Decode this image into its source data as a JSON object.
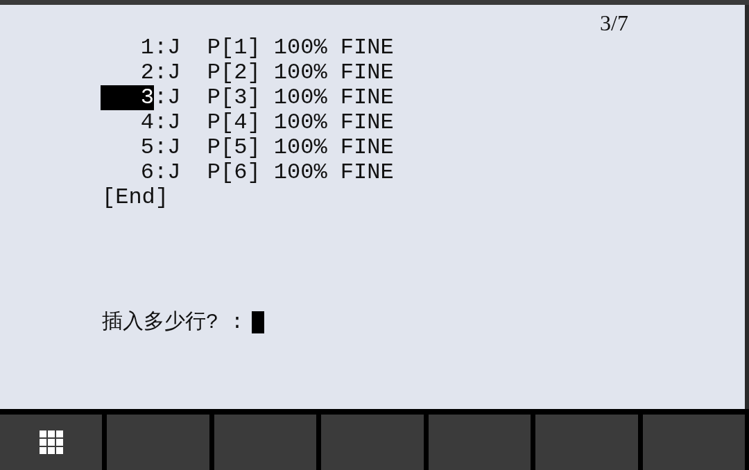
{
  "page_indicator": "3/7",
  "lines": [
    {
      "number": "1",
      "text": ":J  P[1] 100% FINE",
      "selected": false
    },
    {
      "number": "2",
      "text": ":J  P[2] 100% FINE",
      "selected": false
    },
    {
      "number": "3",
      "text": ":J  P[3] 100% FINE",
      "selected": true
    },
    {
      "number": "4",
      "text": ":J  P[4] 100% FINE",
      "selected": false
    },
    {
      "number": "5",
      "text": ":J  P[5] 100% FINE",
      "selected": false
    },
    {
      "number": "6",
      "text": ":J  P[6] 100% FINE",
      "selected": false
    }
  ],
  "end_marker": "[End]",
  "prompt": {
    "text": "插入多少行? :"
  },
  "function_keys": [
    {
      "kind": "menu"
    },
    {
      "kind": "blank"
    },
    {
      "kind": "blank"
    },
    {
      "kind": "blank"
    },
    {
      "kind": "blank"
    },
    {
      "kind": "blank"
    },
    {
      "kind": "blank"
    }
  ]
}
